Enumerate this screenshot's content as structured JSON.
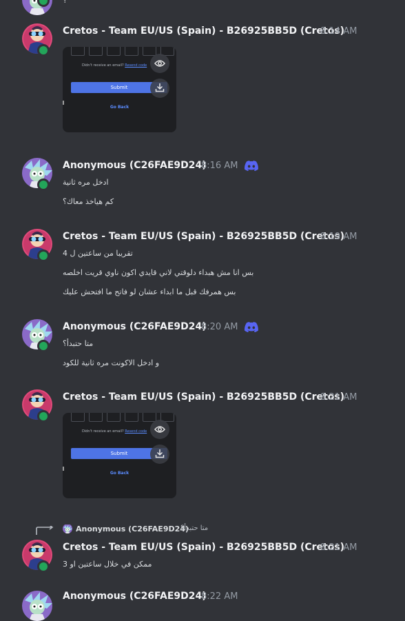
{
  "colors": {
    "background": "#313338",
    "status_online": "#23a55a",
    "discord_blurple": "#5865f2",
    "link": "#5b8cff"
  },
  "top_fragment": "؟",
  "icons": {
    "view": "eye-icon",
    "download": "download-icon",
    "badge": "discord-logo-icon",
    "reply": "reply-arrow-icon"
  },
  "attachment": {
    "hint_text": "Didn't receive an email?",
    "hint_link": "Resend code",
    "submit_label": "Submit",
    "go_back_label": "Go Back"
  },
  "messages": [
    {
      "author": "Cretos - Team EU/US (Spain) - B26925BB5D (Cretos)",
      "time": "8:14 AM",
      "lines": []
    },
    {
      "author": "Anonymous (C26FAE9D24)",
      "time": "8:16 AM",
      "lines": [
        "ادخل مره ثانية",
        "كم هياخذ معاك؟"
      ]
    },
    {
      "author": "Cretos - Team EU/US (Spain) - B26925BB5D (Cretos)",
      "time": "8:19 AM",
      "lines": [
        "تقريبا من ساعتين ل 4",
        "بس انا مش هبداء دلوقتي لاني قايدي اكون ناوي قريت اخلصه",
        "بس همرفك قبل ما ابداء عشان لو فاتح ما افتحش عليك"
      ]
    },
    {
      "author": "Anonymous (C26FAE9D24)",
      "time": "8:20 AM",
      "lines": [
        "متا حتبدأ؟",
        "و ادخل الاكونت مره ثانية للكود"
      ]
    },
    {
      "author": "Cretos - Team EU/US (Spain) - B26925BB5D (Cretos)",
      "time": "8:21 AM",
      "lines": []
    },
    {
      "author": "Cretos - Team EU/US (Spain) - B26925BB5D (Cretos)",
      "time": "8:21 AM",
      "lines": [
        "ممكن في خلال ساعتين او 3"
      ]
    },
    {
      "author": "Anonymous (C26FAE9D24)",
      "time": "8:22 AM",
      "lines": []
    }
  ],
  "reply": {
    "author": "Anonymous (C26FAE9D24)",
    "text": "متا حتبدأ؟"
  }
}
